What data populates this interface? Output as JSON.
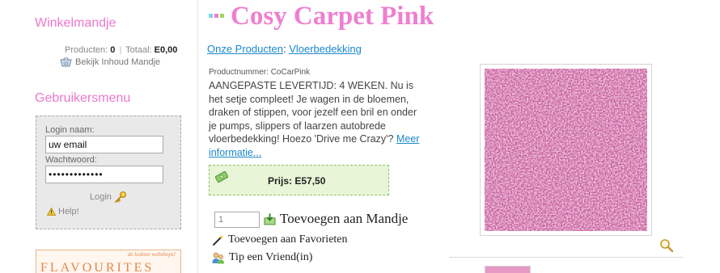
{
  "sidebar": {
    "cart": {
      "heading": "Winkelmandje",
      "products_label": "Producten:",
      "products_count": "0",
      "total_label": "Totaal:",
      "total_value": "E0,00",
      "view_link": "Bekijk Inhoud Mandje"
    },
    "usermenu": {
      "heading": "Gebruikersmenu",
      "login_label": "Login naam:",
      "login_value": "uw email",
      "password_label": "Wachtwoord:",
      "password_value": "•••••••••••••",
      "login_button": "Login",
      "help_link": "Help!"
    },
    "banner": {
      "tagline": "de leukste webshops!",
      "word": "FLAVOURITES"
    }
  },
  "product": {
    "title": "Cosy Carpet Pink",
    "breadcrumb": {
      "cat1": "Onze Producten",
      "separator": ":",
      "cat2": "Vloerbedekking"
    },
    "number": "Productnummer: CoCarPink",
    "description": "AANGEPASTE LEVERTIJD: 4 WEKEN. Nu is het setje compleet! Je wagen in de bloemen, draken of stippen, voor jezelf een bril en onder je pumps, slippers of laarzen autobrede vloerbedekking! Hoezo 'Drive me Crazy'?",
    "more_link": "Meer informatie...",
    "price": "Prijs: E57,50",
    "quantity_placeholder": "1",
    "add_to_cart": "Toevoegen aan Mandje",
    "add_to_favorites": "Toevoegen aan Favorieten",
    "tip_friend": "Tip een Vriend(in)"
  },
  "colors": {
    "pink": "#ee7fd0",
    "link": "#1a88cc",
    "price_bg": "#e8f5d7"
  },
  "icons": [
    "basket-icon",
    "key-icon",
    "warning-icon",
    "money-icon",
    "cart-add-icon",
    "magic-wand-icon",
    "users-icon",
    "zoom-icon"
  ]
}
